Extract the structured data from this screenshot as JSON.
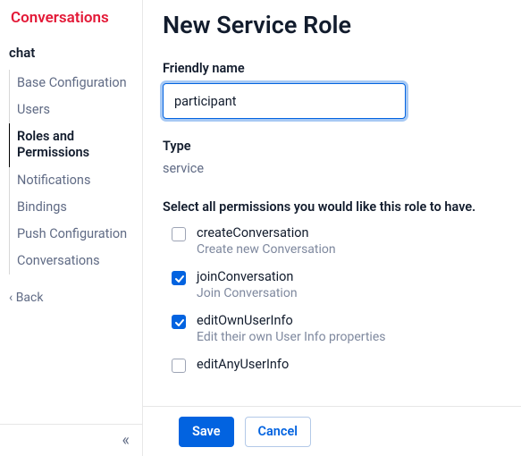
{
  "sidebar": {
    "title": "Conversations",
    "section": "chat",
    "items": [
      {
        "label": "Base Configuration"
      },
      {
        "label": "Users"
      },
      {
        "label": "Roles and Permissions"
      },
      {
        "label": "Notifications"
      },
      {
        "label": "Bindings"
      },
      {
        "label": "Push Configuration"
      },
      {
        "label": "Conversations"
      }
    ],
    "back": "Back",
    "collapse_glyph": "«"
  },
  "page": {
    "heading": "New Service Role",
    "friendly_label": "Friendly name",
    "friendly_value": "participant",
    "type_label": "Type",
    "type_value": "service",
    "perm_instruction": "Select all permissions you would like this role to have.",
    "permissions": [
      {
        "name": "createConversation",
        "desc": "Create new Conversation",
        "checked": false
      },
      {
        "name": "joinConversation",
        "desc": "Join Conversation",
        "checked": true
      },
      {
        "name": "editOwnUserInfo",
        "desc": "Edit their own User Info properties",
        "checked": true
      },
      {
        "name": "editAnyUserInfo",
        "desc": "",
        "checked": false
      }
    ],
    "save": "Save",
    "cancel": "Cancel"
  }
}
